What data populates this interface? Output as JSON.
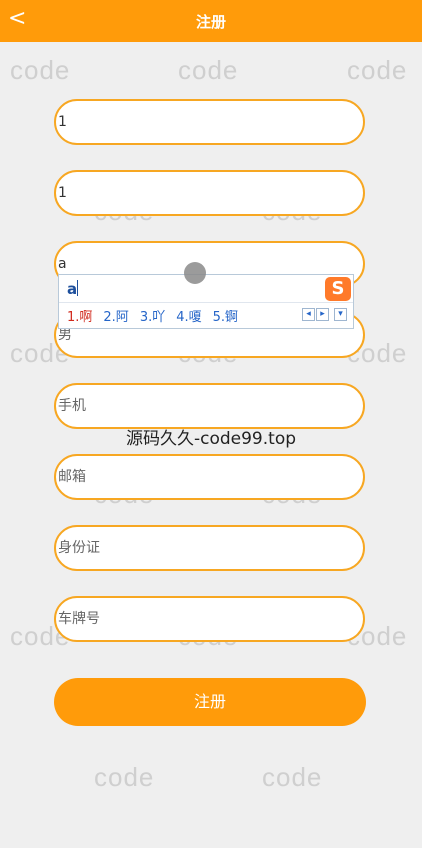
{
  "header": {
    "back_icon": "chevron-left-icon",
    "back_glyph": "<",
    "title": "注册"
  },
  "watermark": {
    "text": "code",
    "center_text": "源码久久-code99.top"
  },
  "form": {
    "fields": [
      {
        "name": "username",
        "value": "1",
        "placeholder": ""
      },
      {
        "name": "password",
        "value": "1",
        "placeholder": ""
      },
      {
        "name": "realname",
        "value": "a",
        "placeholder": ""
      },
      {
        "name": "gender",
        "value": "",
        "placeholder": "男"
      },
      {
        "name": "phone",
        "value": "",
        "placeholder": "手机"
      },
      {
        "name": "email",
        "value": "",
        "placeholder": "邮箱"
      },
      {
        "name": "idcard",
        "value": "",
        "placeholder": "身份证"
      },
      {
        "name": "plate",
        "value": "",
        "placeholder": "车牌号"
      }
    ],
    "submit_label": "注册"
  },
  "ime": {
    "typed": "a",
    "candidates": [
      "1.啊",
      "2.阿",
      "3.吖",
      "4.嗄",
      "5.锕"
    ],
    "logo": "S",
    "nav": [
      "◂",
      "▸",
      "▾"
    ]
  },
  "colors": {
    "accent": "#ff9b0a",
    "field_border": "#f7a722",
    "background": "#efefef"
  }
}
